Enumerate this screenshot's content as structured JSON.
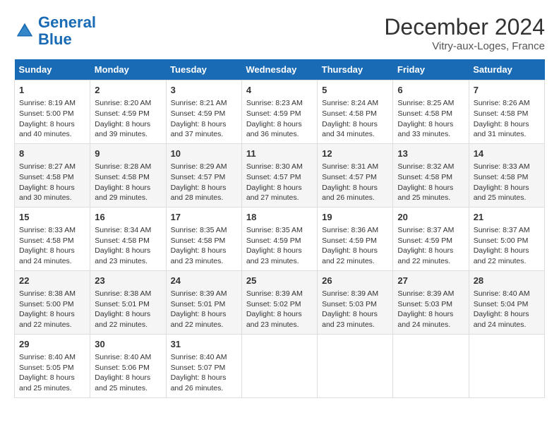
{
  "logo": {
    "line1": "General",
    "line2": "Blue"
  },
  "header": {
    "title": "December 2024",
    "location": "Vitry-aux-Loges, France"
  },
  "days_of_week": [
    "Sunday",
    "Monday",
    "Tuesday",
    "Wednesday",
    "Thursday",
    "Friday",
    "Saturday"
  ],
  "weeks": [
    [
      {
        "day": "1",
        "info": "Sunrise: 8:19 AM\nSunset: 5:00 PM\nDaylight: 8 hours\nand 40 minutes."
      },
      {
        "day": "2",
        "info": "Sunrise: 8:20 AM\nSunset: 4:59 PM\nDaylight: 8 hours\nand 39 minutes."
      },
      {
        "day": "3",
        "info": "Sunrise: 8:21 AM\nSunset: 4:59 PM\nDaylight: 8 hours\nand 37 minutes."
      },
      {
        "day": "4",
        "info": "Sunrise: 8:23 AM\nSunset: 4:59 PM\nDaylight: 8 hours\nand 36 minutes."
      },
      {
        "day": "5",
        "info": "Sunrise: 8:24 AM\nSunset: 4:58 PM\nDaylight: 8 hours\nand 34 minutes."
      },
      {
        "day": "6",
        "info": "Sunrise: 8:25 AM\nSunset: 4:58 PM\nDaylight: 8 hours\nand 33 minutes."
      },
      {
        "day": "7",
        "info": "Sunrise: 8:26 AM\nSunset: 4:58 PM\nDaylight: 8 hours\nand 31 minutes."
      }
    ],
    [
      {
        "day": "8",
        "info": "Sunrise: 8:27 AM\nSunset: 4:58 PM\nDaylight: 8 hours\nand 30 minutes."
      },
      {
        "day": "9",
        "info": "Sunrise: 8:28 AM\nSunset: 4:58 PM\nDaylight: 8 hours\nand 29 minutes."
      },
      {
        "day": "10",
        "info": "Sunrise: 8:29 AM\nSunset: 4:57 PM\nDaylight: 8 hours\nand 28 minutes."
      },
      {
        "day": "11",
        "info": "Sunrise: 8:30 AM\nSunset: 4:57 PM\nDaylight: 8 hours\nand 27 minutes."
      },
      {
        "day": "12",
        "info": "Sunrise: 8:31 AM\nSunset: 4:57 PM\nDaylight: 8 hours\nand 26 minutes."
      },
      {
        "day": "13",
        "info": "Sunrise: 8:32 AM\nSunset: 4:58 PM\nDaylight: 8 hours\nand 25 minutes."
      },
      {
        "day": "14",
        "info": "Sunrise: 8:33 AM\nSunset: 4:58 PM\nDaylight: 8 hours\nand 25 minutes."
      }
    ],
    [
      {
        "day": "15",
        "info": "Sunrise: 8:33 AM\nSunset: 4:58 PM\nDaylight: 8 hours\nand 24 minutes."
      },
      {
        "day": "16",
        "info": "Sunrise: 8:34 AM\nSunset: 4:58 PM\nDaylight: 8 hours\nand 23 minutes."
      },
      {
        "day": "17",
        "info": "Sunrise: 8:35 AM\nSunset: 4:58 PM\nDaylight: 8 hours\nand 23 minutes."
      },
      {
        "day": "18",
        "info": "Sunrise: 8:35 AM\nSunset: 4:59 PM\nDaylight: 8 hours\nand 23 minutes."
      },
      {
        "day": "19",
        "info": "Sunrise: 8:36 AM\nSunset: 4:59 PM\nDaylight: 8 hours\nand 22 minutes."
      },
      {
        "day": "20",
        "info": "Sunrise: 8:37 AM\nSunset: 4:59 PM\nDaylight: 8 hours\nand 22 minutes."
      },
      {
        "day": "21",
        "info": "Sunrise: 8:37 AM\nSunset: 5:00 PM\nDaylight: 8 hours\nand 22 minutes."
      }
    ],
    [
      {
        "day": "22",
        "info": "Sunrise: 8:38 AM\nSunset: 5:00 PM\nDaylight: 8 hours\nand 22 minutes."
      },
      {
        "day": "23",
        "info": "Sunrise: 8:38 AM\nSunset: 5:01 PM\nDaylight: 8 hours\nand 22 minutes."
      },
      {
        "day": "24",
        "info": "Sunrise: 8:39 AM\nSunset: 5:01 PM\nDaylight: 8 hours\nand 22 minutes."
      },
      {
        "day": "25",
        "info": "Sunrise: 8:39 AM\nSunset: 5:02 PM\nDaylight: 8 hours\nand 23 minutes."
      },
      {
        "day": "26",
        "info": "Sunrise: 8:39 AM\nSunset: 5:03 PM\nDaylight: 8 hours\nand 23 minutes."
      },
      {
        "day": "27",
        "info": "Sunrise: 8:39 AM\nSunset: 5:03 PM\nDaylight: 8 hours\nand 24 minutes."
      },
      {
        "day": "28",
        "info": "Sunrise: 8:40 AM\nSunset: 5:04 PM\nDaylight: 8 hours\nand 24 minutes."
      }
    ],
    [
      {
        "day": "29",
        "info": "Sunrise: 8:40 AM\nSunset: 5:05 PM\nDaylight: 8 hours\nand 25 minutes."
      },
      {
        "day": "30",
        "info": "Sunrise: 8:40 AM\nSunset: 5:06 PM\nDaylight: 8 hours\nand 25 minutes."
      },
      {
        "day": "31",
        "info": "Sunrise: 8:40 AM\nSunset: 5:07 PM\nDaylight: 8 hours\nand 26 minutes."
      },
      null,
      null,
      null,
      null
    ]
  ]
}
